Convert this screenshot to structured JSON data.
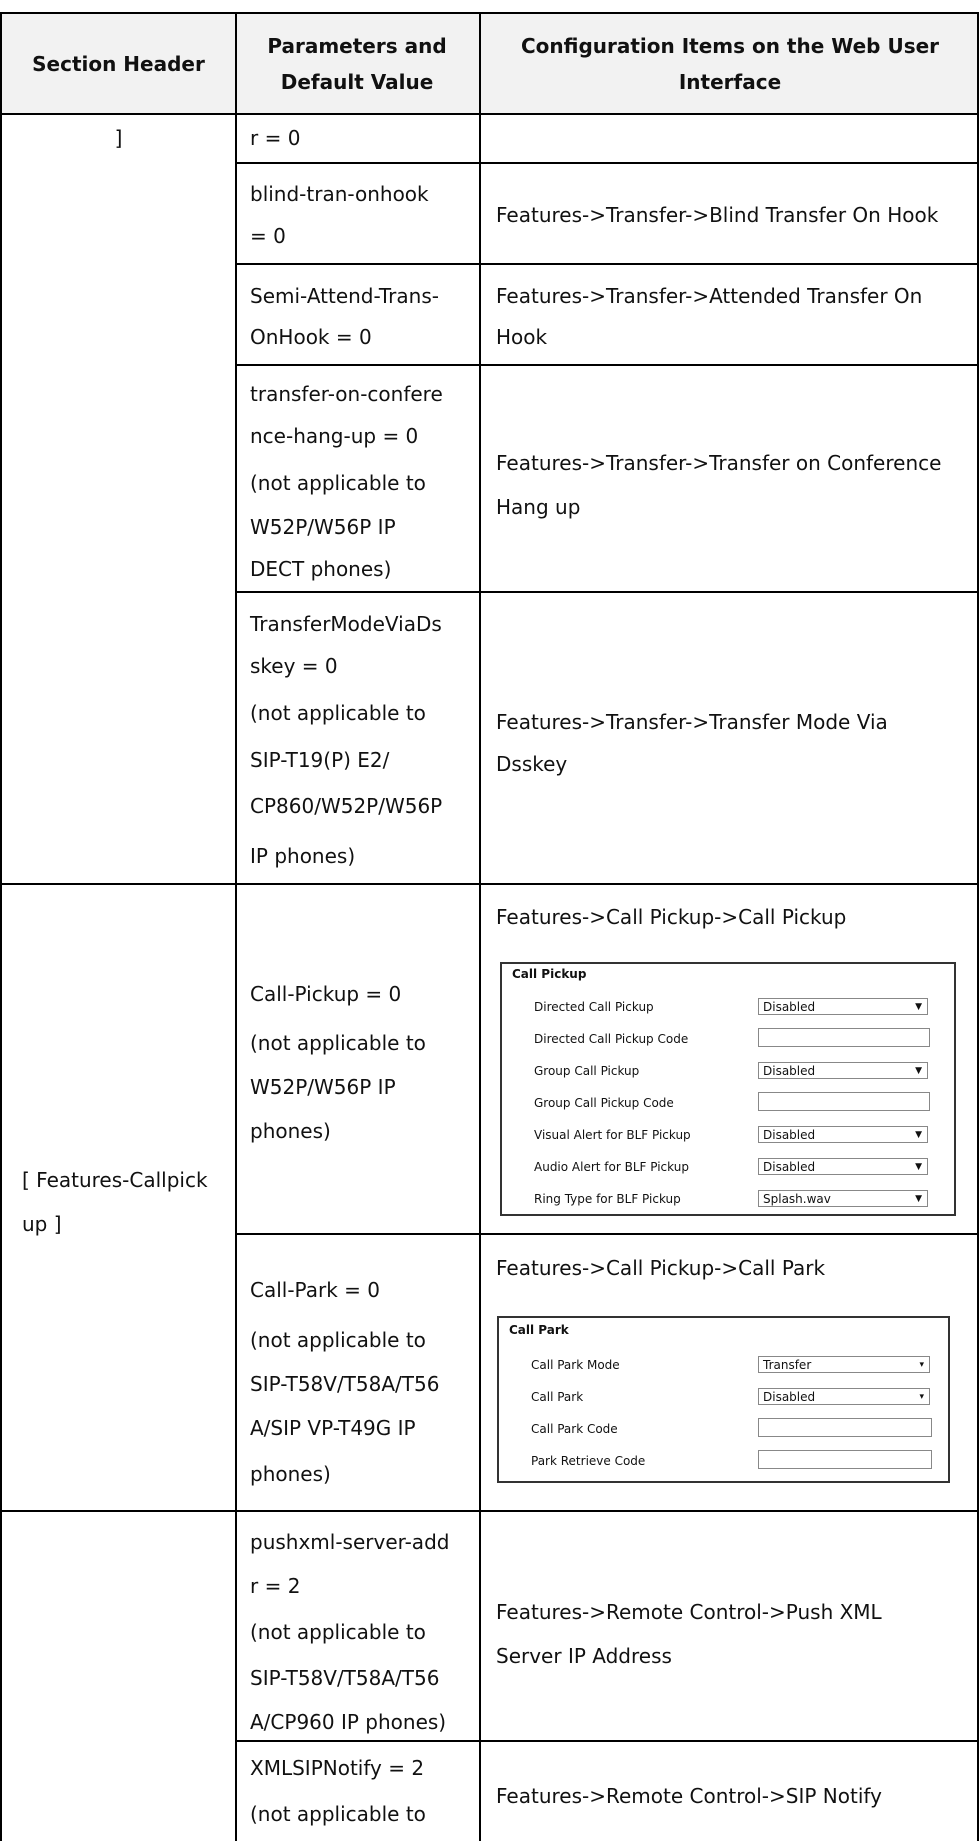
{
  "headers": {
    "col1": "Section Header",
    "col2": "Parameters and Default Value",
    "col3": "Configuration Items on the Web User Interface"
  },
  "rows": {
    "r1": {
      "section": "]",
      "param": [
        "r = 0"
      ],
      "config": []
    },
    "r2": {
      "param": [
        "blind-tran-onhook",
        "= 0"
      ],
      "config": [
        "Features->Transfer->Blind Transfer On Hook"
      ]
    },
    "r3": {
      "param": [
        "Semi-Attend-Trans-",
        "OnHook = 0"
      ],
      "config": [
        "Features->Transfer->Attended Transfer On",
        "Hook"
      ]
    },
    "r4": {
      "param": [
        "transfer-on-confere",
        "nce-hang-up = 0",
        "(not applicable to",
        "W52P/W56P IP",
        "DECT phones)"
      ],
      "config": [
        "Features->Transfer->Transfer on Conference",
        "Hang up"
      ]
    },
    "r5": {
      "param": [
        "TransferModeViaDs",
        "skey = 0",
        "(not applicable to",
        "SIP-T19(P) E2/",
        "CP860/W52P/W56P",
        "IP phones)"
      ],
      "config": [
        "Features->Transfer->Transfer Mode Via",
        "Dsskey"
      ]
    },
    "r6": {
      "section": [
        "[ Features-Callpick",
        "up ]"
      ],
      "param": [
        "Call-Pickup = 0",
        "(not applicable to",
        "W52P/W56P IP",
        "phones)"
      ],
      "config": [
        "Features->Call Pickup->Call Pickup"
      ]
    },
    "r7": {
      "param": [
        "Call-Park = 0",
        "(not applicable to",
        "SIP-T58V/T58A/T56",
        "A/SIP VP-T49G IP",
        "phones)"
      ],
      "config": [
        "Features->Call Pickup->Call Park"
      ]
    },
    "r8": {
      "param": [
        "pushxml-server-add",
        "r = 2",
        "(not applicable to",
        "SIP-T58V/T58A/T56",
        "A/CP960 IP phones)"
      ],
      "config": [
        "Features->Remote Control->Push XML",
        "Server IP Address"
      ]
    },
    "r9": {
      "param": [
        "XMLSIPNotify = 2",
        "(not applicable to"
      ],
      "config": [
        "Features->Remote Control->SIP Notify"
      ]
    }
  },
  "call_pickup_panel": {
    "title": "Call Pickup",
    "items": [
      {
        "label": "Directed Call Pickup",
        "type": "select",
        "value": "Disabled"
      },
      {
        "label": "Directed Call Pickup Code",
        "type": "input",
        "value": ""
      },
      {
        "label": "Group Call Pickup",
        "type": "select",
        "value": "Disabled"
      },
      {
        "label": "Group Call Pickup Code",
        "type": "input",
        "value": ""
      },
      {
        "label": "Visual Alert for BLF Pickup",
        "type": "select",
        "value": "Disabled"
      },
      {
        "label": "Audio Alert for BLF Pickup",
        "type": "select",
        "value": "Disabled"
      },
      {
        "label": "Ring Type for BLF Pickup",
        "type": "select",
        "value": "Splash.wav"
      }
    ]
  },
  "call_park_panel": {
    "title": "Call Park",
    "items": [
      {
        "label": "Call Park Mode",
        "type": "select",
        "value": "Transfer"
      },
      {
        "label": "Call Park",
        "type": "select",
        "value": "Disabled"
      },
      {
        "label": "Call Park Code",
        "type": "input",
        "value": ""
      },
      {
        "label": "Park Retrieve Code",
        "type": "input",
        "value": ""
      }
    ]
  }
}
